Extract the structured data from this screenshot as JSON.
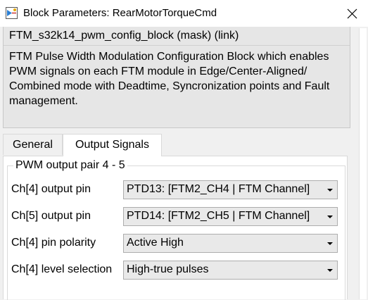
{
  "window": {
    "title": "Block Parameters: RearMotorTorqueCmd"
  },
  "mask": {
    "title": "FTM_s32k14_pwm_config_block (mask) (link)",
    "description": "FTM Pulse Width Modulation Configuration Block which enables PWM signals on each FTM module in Edge/Center-Aligned/ Combined mode with Deadtime, Syncronization points and Fault management."
  },
  "tabs": [
    {
      "label": "General",
      "active": false
    },
    {
      "label": "Output Signals",
      "active": true
    }
  ],
  "group": {
    "title": "PWM output pair 4 - 5"
  },
  "params": [
    {
      "label": "Ch[4] output pin",
      "value": "PTD13: [FTM2_CH4 | FTM Channel]"
    },
    {
      "label": "Ch[5] output pin",
      "value": "PTD14: [FTM2_CH5 | FTM Channel]"
    },
    {
      "label": "Ch[4] pin polarity",
      "value": "Active High"
    },
    {
      "label": "Ch[4] level selection",
      "value": "High-true pulses"
    }
  ]
}
